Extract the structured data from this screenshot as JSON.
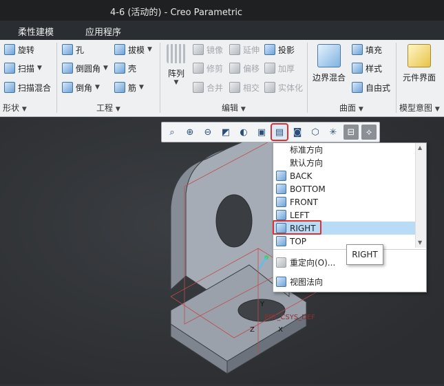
{
  "window": {
    "title": "4-6 (活动的) - Creo Parametric"
  },
  "menu": {
    "tab1": "柔性建模",
    "tab2": "应用程序"
  },
  "ribbon": {
    "shape": {
      "revolve": "旋转",
      "sweep": "扫描",
      "swept_blend": "扫描混合",
      "footer": "形状"
    },
    "engineering": {
      "hole": "孔",
      "round": "倒圆角",
      "chamfer": "倒角",
      "draft": "拔模",
      "shell": "壳",
      "rib": "筋",
      "footer": "工程"
    },
    "editing": {
      "pattern": "阵列",
      "mirror": "镜像",
      "trim": "修剪",
      "merge": "合并",
      "extend": "延伸",
      "offset": "偏移",
      "intersect": "相交",
      "project": "投影",
      "thicken": "加厚",
      "solidify": "实体化",
      "footer": "编辑"
    },
    "surfaces": {
      "boundary_blend": "边界混合",
      "fill": "填充",
      "style": "样式",
      "freestyle": "自由式",
      "footer": "曲面"
    },
    "model_intent": {
      "component_interface": "元件界面",
      "footer": "模型意图"
    }
  },
  "dropdown": {
    "items": [
      {
        "label": "标准方向"
      },
      {
        "label": "默认方向"
      },
      {
        "label": "BACK"
      },
      {
        "label": "BOTTOM"
      },
      {
        "label": "FRONT"
      },
      {
        "label": "LEFT"
      },
      {
        "label": "RIGHT"
      },
      {
        "label": "TOP"
      }
    ],
    "reorient": "重定向(O)...",
    "normal_view": "视图法向"
  },
  "tooltip": "RIGHT",
  "model": {
    "csys_label": "PRT_CSYS_DEF",
    "axis_y": "Y",
    "axis_x": "X",
    "axis_z": "Z"
  },
  "colors": {
    "accent_red": "#d93030",
    "selection_blue": "#b8dcf5",
    "model_gray": "#9ea4ae"
  }
}
